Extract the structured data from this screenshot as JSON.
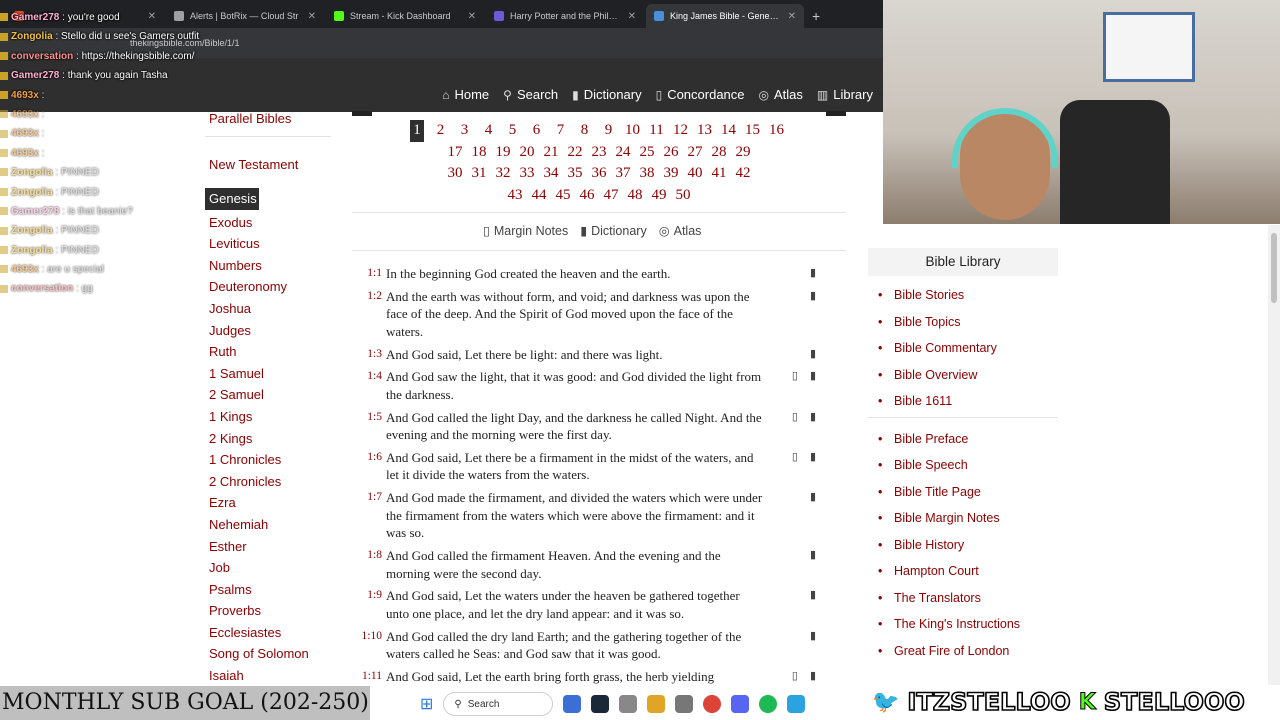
{
  "browser": {
    "tabs": [
      {
        "label": "",
        "color": "#e34c26"
      },
      {
        "label": "Alerts | BotRix — Cloud Str",
        "color": "#9aa0a6"
      },
      {
        "label": "Stream - Kick Dashboard",
        "color": "#53fc18"
      },
      {
        "label": "Harry Potter and the Philosoph",
        "color": "#6b5bd6"
      },
      {
        "label": "King James Bible - Genesis <sp",
        "color": "#4a90d9"
      }
    ],
    "url": "thekingsbible.com/Bible/1/1"
  },
  "nav": {
    "items": [
      {
        "icon": "home-icon",
        "glyph": "⌂",
        "label": "Home"
      },
      {
        "icon": "search-icon",
        "glyph": "⚲",
        "label": "Search"
      },
      {
        "icon": "book-icon",
        "glyph": "▮",
        "label": "Dictionary"
      },
      {
        "icon": "bookmark-icon",
        "glyph": "▯",
        "label": "Concordance"
      },
      {
        "icon": "globe-icon",
        "glyph": "◎",
        "label": "Atlas"
      },
      {
        "icon": "library-icon",
        "glyph": "▥",
        "label": "Library"
      }
    ]
  },
  "sidebar": {
    "parallel": "Parallel Bibles",
    "testament": "New Testament",
    "active_book": "Genesis",
    "books": [
      "Exodus",
      "Leviticus",
      "Numbers",
      "Deuteronomy",
      "Joshua",
      "Judges",
      "Ruth",
      "1 Samuel",
      "2 Samuel",
      "1 Kings",
      "2 Kings",
      "1 Chronicles",
      "2 Chronicles",
      "Ezra",
      "Nehemiah",
      "Esther",
      "Job",
      "Psalms",
      "Proverbs",
      "Ecclesiastes",
      "Song of Solomon",
      "Isaiah"
    ]
  },
  "chapters": {
    "active": "1",
    "rows": [
      [
        "1",
        "2",
        "3",
        "4",
        "5",
        "6",
        "7",
        "8",
        "9",
        "10",
        "11",
        "12",
        "13",
        "14",
        "15",
        "16"
      ],
      [
        "17",
        "18",
        "19",
        "20",
        "21",
        "22",
        "23",
        "24",
        "25",
        "26",
        "27",
        "28",
        "29"
      ],
      [
        "30",
        "31",
        "32",
        "33",
        "34",
        "35",
        "36",
        "37",
        "38",
        "39",
        "40",
        "41",
        "42"
      ],
      [
        "43",
        "44",
        "45",
        "46",
        "47",
        "48",
        "49",
        "50"
      ]
    ]
  },
  "tools": {
    "margin_notes": "Margin Notes",
    "dictionary": "Dictionary",
    "atlas": "Atlas"
  },
  "verses": [
    {
      "num": "1:1",
      "text": "In the beginning God created the heaven and the earth.",
      "bookmark": false
    },
    {
      "num": "1:2",
      "text": "And the earth was without form, and void; and darkness was upon the face of the deep. And the Spirit of God moved upon the face of the waters.",
      "bookmark": false
    },
    {
      "num": "1:3",
      "text": "And God said, Let there be light: and there was light.",
      "bookmark": false
    },
    {
      "num": "1:4",
      "text": "And God saw the light, that it was good: and God divided the light from the darkness.",
      "bookmark": true
    },
    {
      "num": "1:5",
      "text": "And God called the light Day, and the darkness he called Night. And the evening and the morning were the first day.",
      "bookmark": true
    },
    {
      "num": "1:6",
      "text": "And God said, Let there be a firmament in the midst of the waters, and let it divide the waters from the waters.",
      "bookmark": true
    },
    {
      "num": "1:7",
      "text": "And God made the firmament, and divided the waters which were under the firmament from the waters which were above the firmament: and it was so.",
      "bookmark": false
    },
    {
      "num": "1:8",
      "text": "And God called the firmament Heaven. And the evening and the morning were the second day.",
      "bookmark": false
    },
    {
      "num": "1:9",
      "text": "And God said, Let the waters under the heaven be gathered together unto one place, and let the dry land appear: and it was so.",
      "bookmark": false
    },
    {
      "num": "1:10",
      "text": "And God called the dry land Earth; and the gathering together of the waters called he Seas: and God saw that it was good.",
      "bookmark": false
    },
    {
      "num": "1:11",
      "text": "And God said, Let the earth bring forth grass, the herb yielding",
      "bookmark": true
    }
  ],
  "library": {
    "title": "Bible Library",
    "group1": [
      "Bible Stories",
      "Bible Topics",
      "Bible Commentary",
      "Bible Overview",
      "Bible 1611"
    ],
    "group2": [
      "Bible Preface",
      "Bible Speech",
      "Bible Title Page",
      "Bible Margin Notes",
      "Bible History",
      "Hampton Court",
      "The Translators",
      "The King's Instructions",
      "Great Fire of London"
    ]
  },
  "chat": [
    {
      "user": "Gamer278",
      "msg": "you're good",
      "faded": false
    },
    {
      "user": "Zongolia",
      "msg": "Stello did u see's Gamers outfit",
      "faded": false
    },
    {
      "user": "conversation",
      "msg": "https://thekingsbible.com/",
      "faded": false
    },
    {
      "user": "Gamer278",
      "msg": "thank you again Tasha",
      "faded": false
    },
    {
      "user": "4693x",
      "msg": "",
      "faded": false
    },
    {
      "user": "4693x",
      "msg": "",
      "faded": true
    },
    {
      "user": "4693x",
      "msg": "",
      "faded": true
    },
    {
      "user": "4693x",
      "msg": "",
      "faded": true
    },
    {
      "user": "Zongolia",
      "msg": "PINNED",
      "faded": true
    },
    {
      "user": "Zongolia",
      "msg": "PINNED",
      "faded": true
    },
    {
      "user": "Gamer278",
      "msg": "is that beanie?",
      "faded": true
    },
    {
      "user": "Zongolia",
      "msg": "PINNED",
      "faded": true
    },
    {
      "user": "Zongolia",
      "msg": "PINNED",
      "faded": true
    },
    {
      "user": "4693x",
      "msg": "are u special",
      "faded": true
    },
    {
      "user": "conversation",
      "msg": "gg",
      "faded": true
    }
  ],
  "overlay": {
    "goal": "MONTHLY SUB GOAL (202-250)",
    "taskbar_search": "Search",
    "twitter_handle": "ITZSTELLOO",
    "kick_handle": "STELLOOO"
  },
  "colors": {
    "accent": "#8b0000",
    "nav_bg": "#2f2f2f"
  }
}
